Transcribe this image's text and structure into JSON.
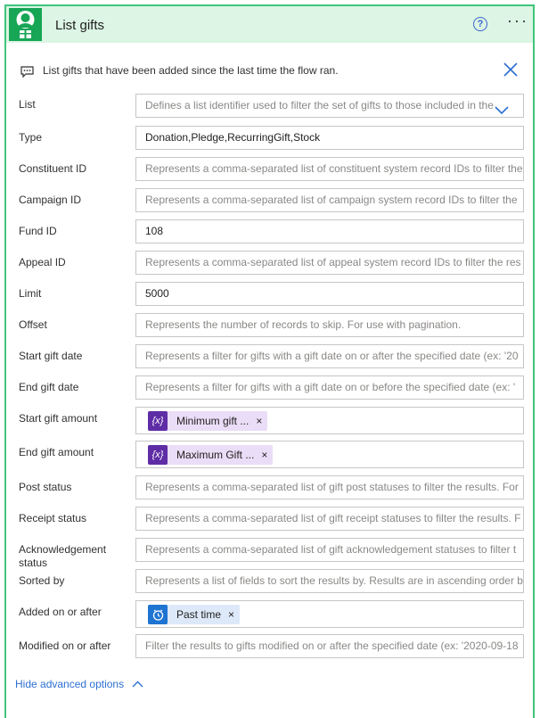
{
  "header": {
    "title": "List gifts"
  },
  "description": "List gifts that have been added since the last time the flow ran.",
  "fields": [
    {
      "label": "List",
      "placeholder": "Defines a list identifier used to filter the set of gifts to those included in the"
    },
    {
      "label": "Type",
      "value": "Donation,Pledge,RecurringGift,Stock"
    },
    {
      "label": "Constituent ID",
      "placeholder": "Represents a comma-separated list of constituent system record IDs to filter the"
    },
    {
      "label": "Campaign ID",
      "placeholder": "Represents a comma-separated list of campaign system record IDs to filter the"
    },
    {
      "label": "Fund ID",
      "value": "108"
    },
    {
      "label": "Appeal ID",
      "placeholder": "Represents a comma-separated list of appeal system record IDs to filter the res"
    },
    {
      "label": "Limit",
      "value": "5000"
    },
    {
      "label": "Offset",
      "placeholder": "Represents the number of records to skip. For use with pagination."
    },
    {
      "label": "Start gift date",
      "placeholder": "Represents a filter for gifts with a gift date on or after the specified date (ex: '20"
    },
    {
      "label": "End gift date",
      "placeholder": "Represents a filter for gifts with a gift date on or before the specified date (ex: '"
    },
    {
      "label": "Start gift amount",
      "token": "Minimum gift ...",
      "token_icon": "{x}"
    },
    {
      "label": "End gift amount",
      "token": "Maximum Gift ...",
      "token_icon": "{x}"
    },
    {
      "label": "Post status",
      "placeholder": "Represents a comma-separated list of gift post statuses to filter the results. For"
    },
    {
      "label": "Receipt status",
      "placeholder": "Represents a comma-separated list of gift receipt statuses to filter the results. F"
    },
    {
      "label": "Acknowledgement status",
      "placeholder": "Represents a comma-separated list of gift acknowledgement statuses to filter t"
    },
    {
      "label": "Sorted by",
      "placeholder": "Represents a list of fields to sort the results by. Results are in ascending order b"
    },
    {
      "label": "Added on or after",
      "token": "Past time"
    },
    {
      "label": "Modified on or after",
      "placeholder": "Filter the results to gifts modified on or after the specified date (ex: '2020-09-18"
    }
  ],
  "footer": {
    "hide_advanced": "Hide advanced options"
  },
  "token_remove": "×",
  "colors": {
    "accent": "#3fc47a",
    "header_bg": "#dcf5e4",
    "logo": "#17a556",
    "expression_token": "#5e2ca5",
    "clock_token": "#1f74d1"
  },
  "icons": [
    "user-gift-icon",
    "help-icon",
    "more-icon",
    "comment-icon",
    "close-icon",
    "chevron-down-icon",
    "expression-icon",
    "clock-icon",
    "chevron-up-icon"
  ]
}
